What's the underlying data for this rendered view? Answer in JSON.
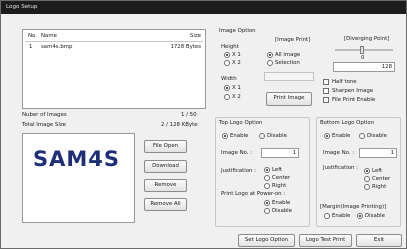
{
  "window": {
    "title": "Logo Setup"
  },
  "file_list": {
    "headers": {
      "no": "No.",
      "name": "Name",
      "size": "Size"
    },
    "rows": [
      {
        "no": "1",
        "name": "sam4s.bmp",
        "size": "1728 Bytes"
      }
    ]
  },
  "summary": {
    "images_label": "Nuber of Images",
    "images_value": "1 / 50",
    "size_label": "Total Image Size",
    "size_value": "2 / 128 KByte"
  },
  "preview": {
    "logo_text": "SAM4S"
  },
  "file_buttons": {
    "open": "File Open",
    "download": "Download",
    "remove": "Remove",
    "remove_all": "Remove All"
  },
  "image_option": {
    "title": "Image Option",
    "image_print_label": "[Image Print]",
    "diverging_label": "[Diverging Point]",
    "height_label": "Height",
    "height_x1": "X 1",
    "height_x2": "X 2",
    "all_image": "All image",
    "selection": "Selection",
    "width_label": "Width",
    "width_x1": "X 1",
    "width_x2": "X 2",
    "print_image": "Print Image",
    "slider_value": "0",
    "diverging_value": "128",
    "half_tone": "Half tone",
    "sharpen": "Sharpen Image",
    "file_print_enable": "File Print Enable"
  },
  "top_logo": {
    "title": "Top Logo Option",
    "enable": "Enable",
    "disable": "Disable",
    "image_no_label": "Image No. :",
    "image_no_value": "1",
    "justification_label": "Justification :",
    "left": "Left",
    "center": "Center",
    "right": "Right",
    "power_on_label": "Print Logo at Power-on :",
    "power_enable": "Enable",
    "power_disable": "Disable"
  },
  "bottom_logo": {
    "title": "Bottom Logo Option",
    "enable": "Enable",
    "disable": "Disable",
    "image_no_label": "Image No. :",
    "image_no_value": "1",
    "justification_label": "Justification :",
    "left": "Left",
    "center": "Center",
    "right": "Right",
    "margin_label": "[Margin(Image Printing)]",
    "margin_enable": "Enable",
    "margin_disable": "Disable"
  },
  "footer": {
    "set_logo": "Set Logo Option",
    "test_print": "Logo Test Print",
    "exit": "Exit"
  },
  "colors": {
    "titlebar": "#1c1c1c",
    "logo_navy": "#1e2f78",
    "window_bg": "#f0f0f0"
  }
}
